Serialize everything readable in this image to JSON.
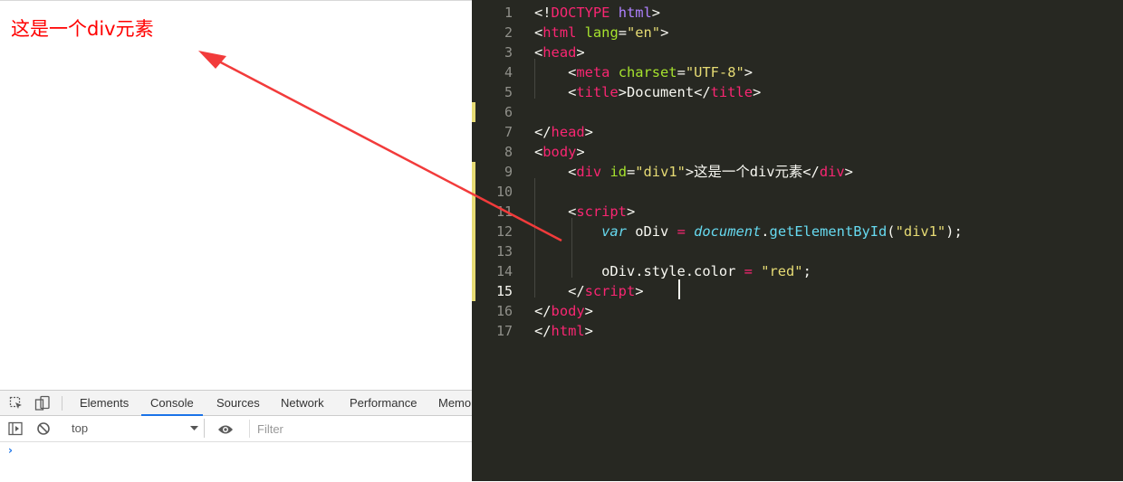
{
  "browser": {
    "page_text": "这是一个div元素",
    "page_text_color": "#ff0000"
  },
  "devtools": {
    "tabs": [
      "Elements",
      "Console",
      "Sources",
      "Network",
      "Performance",
      "Memo"
    ],
    "active_tab": "Console",
    "icons": [
      "inspect-element-icon",
      "device-toolbar-icon",
      "sidebar-toggle-icon",
      "clear-console-icon",
      "dropdown-caret-icon",
      "eye-icon",
      "prompt-chevron-icon"
    ],
    "context": "top",
    "filter_placeholder": "Filter",
    "accent": "#1a73e8"
  },
  "editor": {
    "background": "#272822",
    "modified_lines": [
      6,
      9,
      10,
      11,
      12,
      13,
      14,
      15
    ],
    "cursor_line": 15,
    "lines": [
      {
        "n": "1",
        "tokens": [
          {
            "t": "<!",
            "c": ""
          },
          {
            "t": "DOCTYPE",
            "c": "t-tag"
          },
          {
            "t": " ",
            "c": ""
          },
          {
            "t": "html",
            "c": "t-doc"
          },
          {
            "t": ">",
            "c": ""
          }
        ]
      },
      {
        "n": "2",
        "tokens": [
          {
            "t": "<",
            "c": ""
          },
          {
            "t": "html",
            "c": "t-tag"
          },
          {
            "t": " ",
            "c": ""
          },
          {
            "t": "lang",
            "c": "t-attr"
          },
          {
            "t": "=",
            "c": ""
          },
          {
            "t": "\"en\"",
            "c": "t-str"
          },
          {
            "t": ">",
            "c": ""
          }
        ]
      },
      {
        "n": "3",
        "tokens": [
          {
            "t": "<",
            "c": ""
          },
          {
            "t": "head",
            "c": "t-tag"
          },
          {
            "t": ">",
            "c": ""
          }
        ]
      },
      {
        "n": "4",
        "tokens": [
          {
            "t": "    <",
            "c": ""
          },
          {
            "t": "meta",
            "c": "t-tag"
          },
          {
            "t": " ",
            "c": ""
          },
          {
            "t": "charset",
            "c": "t-attr"
          },
          {
            "t": "=",
            "c": ""
          },
          {
            "t": "\"UTF-8\"",
            "c": "t-str"
          },
          {
            "t": ">",
            "c": ""
          }
        ]
      },
      {
        "n": "5",
        "tokens": [
          {
            "t": "    <",
            "c": ""
          },
          {
            "t": "title",
            "c": "t-tag"
          },
          {
            "t": ">Document</",
            "c": ""
          },
          {
            "t": "title",
            "c": "t-tag"
          },
          {
            "t": ">",
            "c": ""
          }
        ]
      },
      {
        "n": "6",
        "tokens": []
      },
      {
        "n": "7",
        "tokens": [
          {
            "t": "</",
            "c": ""
          },
          {
            "t": "head",
            "c": "t-tag"
          },
          {
            "t": ">",
            "c": ""
          }
        ]
      },
      {
        "n": "8",
        "tokens": [
          {
            "t": "<",
            "c": ""
          },
          {
            "t": "body",
            "c": "t-tag"
          },
          {
            "t": ">",
            "c": ""
          }
        ]
      },
      {
        "n": "9",
        "tokens": [
          {
            "t": "    <",
            "c": ""
          },
          {
            "t": "div",
            "c": "t-tag"
          },
          {
            "t": " ",
            "c": ""
          },
          {
            "t": "id",
            "c": "t-attr"
          },
          {
            "t": "=",
            "c": ""
          },
          {
            "t": "\"div1\"",
            "c": "t-str"
          },
          {
            "t": ">这是一个div元素</",
            "c": ""
          },
          {
            "t": "div",
            "c": "t-tag"
          },
          {
            "t": ">",
            "c": ""
          }
        ]
      },
      {
        "n": "10",
        "tokens": []
      },
      {
        "n": "11",
        "tokens": [
          {
            "t": "    <",
            "c": ""
          },
          {
            "t": "script",
            "c": "t-tag"
          },
          {
            "t": ">",
            "c": ""
          }
        ]
      },
      {
        "n": "12",
        "tokens": [
          {
            "t": "        ",
            "c": ""
          },
          {
            "t": "var",
            "c": "t-key"
          },
          {
            "t": " oDiv ",
            "c": ""
          },
          {
            "t": "=",
            "c": "t-op"
          },
          {
            "t": " ",
            "c": ""
          },
          {
            "t": "document",
            "c": "t-key"
          },
          {
            "t": ".",
            "c": ""
          },
          {
            "t": "getElementById",
            "c": "t-fn"
          },
          {
            "t": "(",
            "c": ""
          },
          {
            "t": "\"div1\"",
            "c": "t-str"
          },
          {
            "t": ");",
            "c": ""
          }
        ]
      },
      {
        "n": "13",
        "tokens": []
      },
      {
        "n": "14",
        "tokens": [
          {
            "t": "        oDiv.style.color ",
            "c": ""
          },
          {
            "t": "=",
            "c": "t-op"
          },
          {
            "t": " ",
            "c": ""
          },
          {
            "t": "\"red\"",
            "c": "t-str"
          },
          {
            "t": ";",
            "c": ""
          }
        ]
      },
      {
        "n": "15",
        "tokens": [
          {
            "t": "    </",
            "c": ""
          },
          {
            "t": "script",
            "c": "t-tag"
          },
          {
            "t": ">",
            "c": ""
          }
        ]
      },
      {
        "n": "16",
        "tokens": [
          {
            "t": "</",
            "c": ""
          },
          {
            "t": "body",
            "c": "t-tag"
          },
          {
            "t": ">",
            "c": ""
          }
        ]
      },
      {
        "n": "17",
        "tokens": [
          {
            "t": "</",
            "c": ""
          },
          {
            "t": "html",
            "c": "t-tag"
          },
          {
            "t": ">",
            "c": ""
          }
        ]
      }
    ]
  },
  "annotation": {
    "icon": "annotation-arrow-icon",
    "color": "#f23b3b"
  }
}
